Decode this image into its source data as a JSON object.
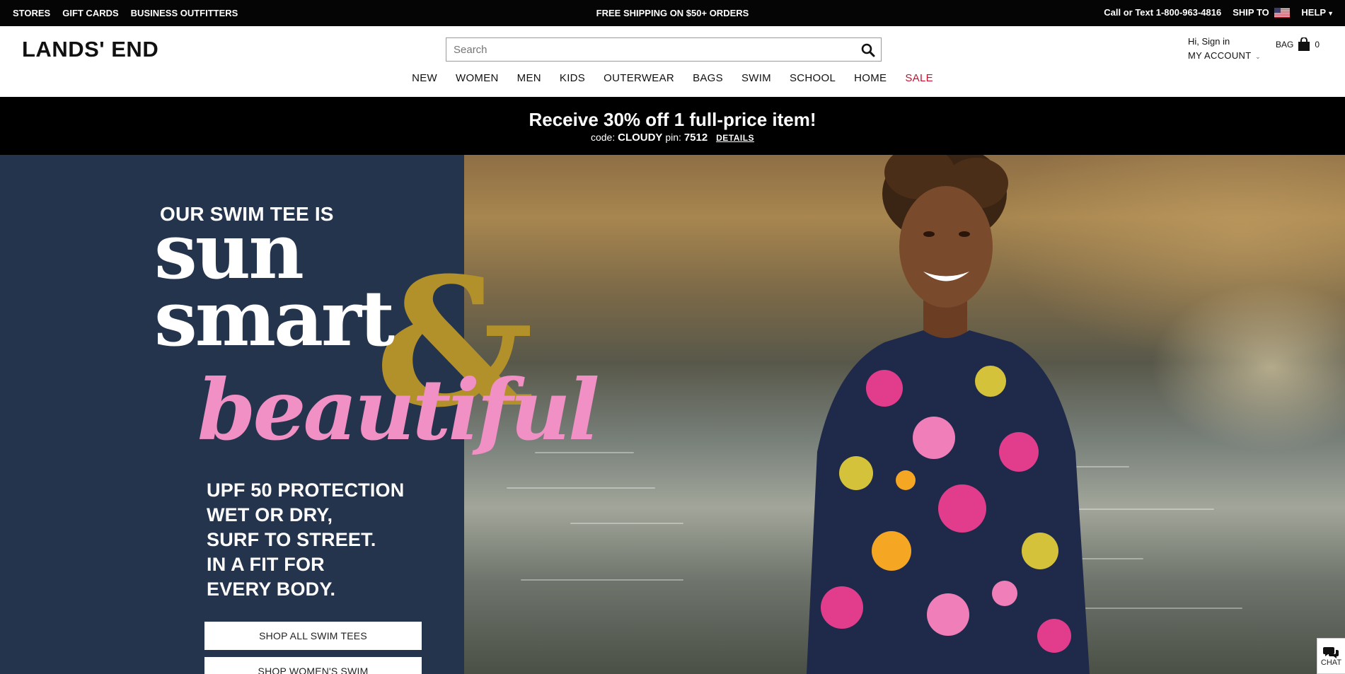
{
  "utility_bar": {
    "left_links": [
      "STORES",
      "GIFT CARDS",
      "BUSINESS OUTFITTERS"
    ],
    "center_text": "FREE SHIPPING ON $50+ ORDERS",
    "phone": "Call or Text 1-800-963-4816",
    "ship_to": "SHIP TO",
    "help": "HELP"
  },
  "header": {
    "logo": "LANDS' END",
    "search_placeholder": "Search",
    "account_greeting": "Hi, Sign in",
    "account_label": "MY ACCOUNT",
    "bag_label": "BAG",
    "bag_count": "0"
  },
  "nav": {
    "items": [
      "NEW",
      "WOMEN",
      "MEN",
      "KIDS",
      "OUTERWEAR",
      "BAGS",
      "SWIM",
      "SCHOOL",
      "HOME",
      "SALE"
    ]
  },
  "promo": {
    "headline": "Receive 30% off 1 full-price item!",
    "code_label": "code:",
    "code": "CLOUDY",
    "pin_label": "pin:",
    "pin": "7512",
    "details": "DETAILS"
  },
  "hero": {
    "eyebrow": "OUR SWIM TEE IS",
    "word1": "sun",
    "word2": "smart",
    "ampersand": "&",
    "word3": "beautiful",
    "features": [
      "UPF 50 PROTECTION",
      "WET OR DRY,",
      "SURF TO STREET.",
      "IN A FIT FOR",
      "EVERY BODY."
    ],
    "button1": "SHOP ALL SWIM TEES",
    "button2": "SHOP WOMEN'S SWIM"
  },
  "chat": {
    "label": "CHAT"
  },
  "colors": {
    "hero_panel": "#24344d",
    "amp_gold": "#b2902a",
    "beautiful_pink": "#f090c4",
    "sale_red": "#c8102e"
  }
}
